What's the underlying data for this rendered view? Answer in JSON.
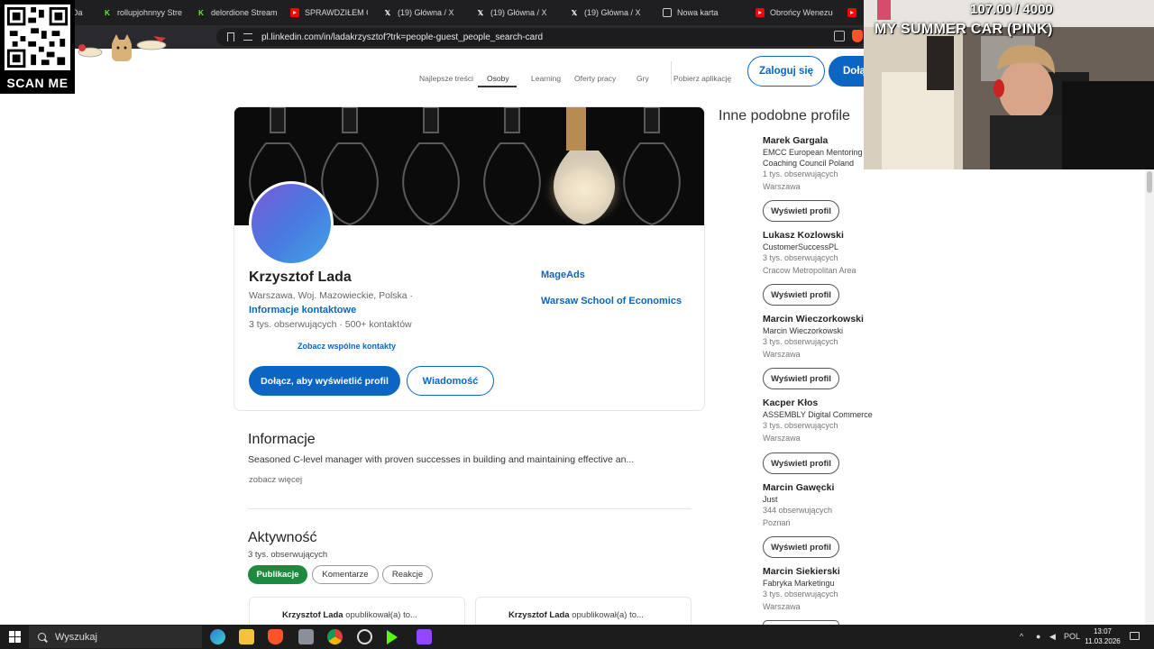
{
  "browser": {
    "tabs": [
      {
        "label": "Da",
        "icon": "partial-tab-icon"
      },
      {
        "label": "rollupjohnnyy Strea",
        "icon": "kick-icon"
      },
      {
        "label": "delordione Stream",
        "icon": "kick-icon"
      },
      {
        "label": "SPRAWDZIŁEM CZY",
        "icon": "youtube-icon"
      },
      {
        "label": "(19) Główna / X",
        "icon": "x-icon"
      },
      {
        "label": "(19) Główna / X",
        "icon": "x-icon"
      },
      {
        "label": "(19) Główna / X",
        "icon": "x-icon"
      },
      {
        "label": "Nowa karta",
        "icon": "brave-shield-icon"
      },
      {
        "label": "Obrońcy Wenezuel",
        "icon": "youtube-icon"
      }
    ],
    "url": "pl.linkedin.com/in/ladakrzysztof?trk=people-guest_people_search-card"
  },
  "overlay": {
    "qr_label": "SCAN ME",
    "webcam_title": "MY SUMMER CAR (PINK)",
    "webcam_counter": "107.00 / 4000"
  },
  "nav": {
    "items": [
      "Najlepsze treści",
      "Osoby",
      "Learning",
      "Oferty pracy",
      "Gry",
      "Pobierz aplikację"
    ],
    "active": "Osoby",
    "login_label": "Zaloguj się",
    "join_label": "Dołą"
  },
  "profile": {
    "name": "Krzysztof Lada",
    "location": "Warszawa, Woj. Mazowieckie, Polska  ·",
    "contact_link": "Informacje kontaktowe",
    "stats": "3 tys. obserwujących  ·  500+ kontaktów",
    "mutual_link": "Zobacz wspólne kontakty",
    "experience": [
      "MageAds",
      "Warsaw School of Economics"
    ],
    "join_button": "Dołącz, aby wyświetlić profil",
    "message_button": "Wiadomość"
  },
  "about": {
    "heading": "Informacje",
    "text": "Seasoned C-level manager with proven successes in building and maintaining effective an...",
    "see_more": "zobacz więcej"
  },
  "activity": {
    "heading": "Aktywność",
    "followers": "3 tys. obserwujących",
    "filters": [
      "Publikacje",
      "Komentarze",
      "Reakcje"
    ],
    "active_filter": "Publikacje",
    "posts": [
      {
        "author": "Krzysztof Lada",
        "text": " opublikował(a) to..."
      },
      {
        "author": "Krzysztof Lada",
        "text": " opublikował(a) to..."
      }
    ]
  },
  "sidebar": {
    "title": "Inne podobne profile",
    "button_label": "Wyświetl profil",
    "profiles": [
      {
        "name": "Marek Gargala",
        "headline": "EMCC European Mentoring",
        "headline2": "Coaching Council Poland",
        "followers": "1 tys. obserwujących",
        "location": "Warszawa"
      },
      {
        "name": "Lukasz Kozlowski",
        "headline": "CustomerSuccessPL",
        "headline2": "",
        "followers": "3 tys. obserwujących",
        "location": "Cracow Metropolitan Area"
      },
      {
        "name": "Marcin Wieczorkowski",
        "headline": "Marcin Wieczorkowski",
        "headline2": "",
        "followers": "3 tys. obserwujących",
        "location": "Warszawa"
      },
      {
        "name": "Kacper Kłos",
        "headline": "ASSEMBLY Digital Commerce",
        "headline2": "",
        "followers": "3 tys. obserwujących",
        "location": "Warszawa"
      },
      {
        "name": "Marcin Gawęcki",
        "headline": "Just",
        "headline2": "",
        "followers": "344 obserwujących",
        "location": "Poznań"
      },
      {
        "name": "Marcin Siekierski",
        "headline": "Fabryka Marketingu",
        "headline2": "",
        "followers": "3 tys. obserwujących",
        "location": "Warszawa"
      }
    ]
  },
  "taskbar": {
    "search_label": "Wyszukaj",
    "language": "POL",
    "time": "13:07",
    "date": "11.03.2026"
  },
  "colors": {
    "linkedin_blue": "#0a66c2",
    "active_filter_green": "#1f8a3f",
    "chrome_dark": "#1f1f22"
  }
}
